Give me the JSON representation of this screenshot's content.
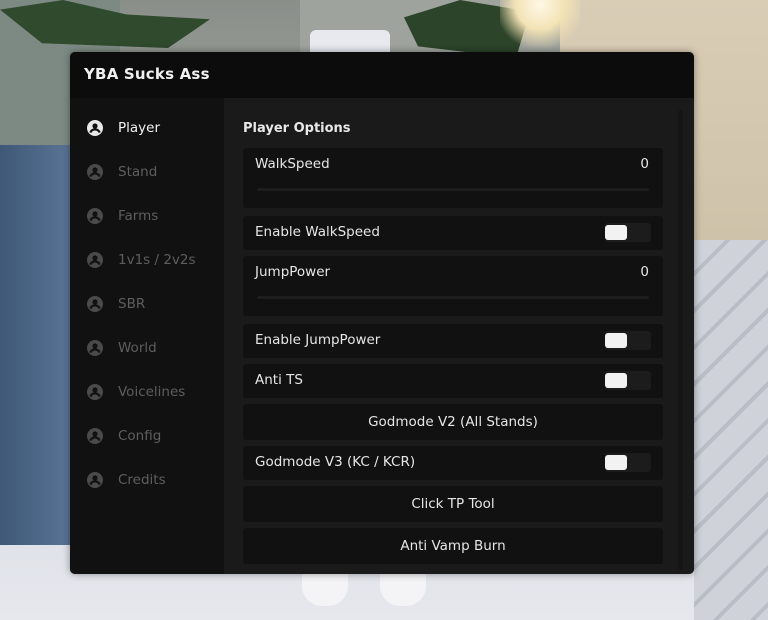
{
  "window": {
    "title": "YBA Sucks Ass"
  },
  "sidebar": {
    "items": [
      {
        "label": "Player",
        "active": true
      },
      {
        "label": "Stand",
        "active": false
      },
      {
        "label": "Farms",
        "active": false
      },
      {
        "label": "1v1s / 2v2s",
        "active": false
      },
      {
        "label": "SBR",
        "active": false
      },
      {
        "label": "World",
        "active": false
      },
      {
        "label": "Voicelines",
        "active": false
      },
      {
        "label": "Config",
        "active": false
      },
      {
        "label": "Credits",
        "active": false
      }
    ],
    "icon": "user-circle-icon"
  },
  "content": {
    "section_title": "Player Options",
    "walkspeed": {
      "label": "WalkSpeed",
      "value": "0"
    },
    "enable_walkspeed": {
      "label": "Enable WalkSpeed",
      "enabled": false
    },
    "jumppower": {
      "label": "JumpPower",
      "value": "0"
    },
    "enable_jumppower": {
      "label": "Enable JumpPower",
      "enabled": false
    },
    "anti_ts": {
      "label": "Anti TS",
      "enabled": false
    },
    "godmode_v2": {
      "label": "Godmode V2 (All Stands)"
    },
    "godmode_v3": {
      "label": "Godmode V3 (KC / KCR)",
      "enabled": false
    },
    "click_tp": {
      "label": "Click TP Tool"
    },
    "anti_vamp": {
      "label": "Anti Vamp Burn"
    }
  },
  "colors": {
    "window_bg": "#141414",
    "sidebar_bg": "#111111",
    "content_bg": "#1a1a1a",
    "row_bg": "#111111",
    "text_active": "#f2f2f2",
    "text_inactive": "#5e5e5e",
    "toggle_knob": "#f2f2f2"
  }
}
